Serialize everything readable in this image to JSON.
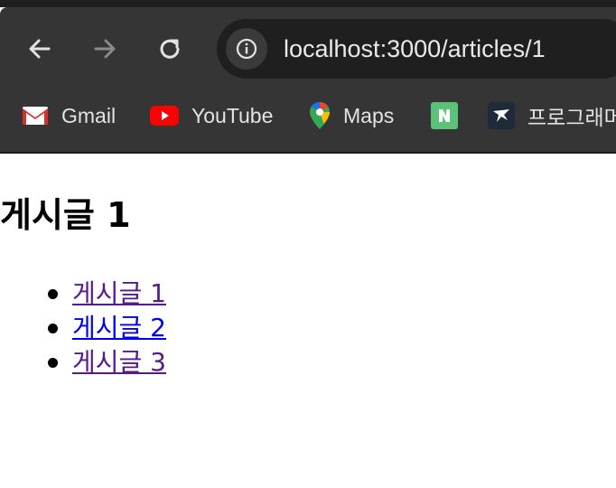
{
  "browser": {
    "url": "localhost:3000/articles/1",
    "bookmarks": [
      {
        "label": "Gmail",
        "icon": "gmail-icon"
      },
      {
        "label": "YouTube",
        "icon": "youtube-icon"
      },
      {
        "label": "Maps",
        "icon": "maps-icon"
      },
      {
        "label": "",
        "icon": "naver-icon"
      },
      {
        "label": "프로그래머",
        "icon": "programmers-icon"
      }
    ]
  },
  "page": {
    "title": "게시글 1",
    "articles": [
      {
        "label": "게시글 1",
        "visited": true
      },
      {
        "label": "게시글 2",
        "visited": false
      },
      {
        "label": "게시글 3",
        "visited": true
      }
    ]
  },
  "colors": {
    "toolbar": "#353535",
    "link_visited": "#551a8b",
    "link_unvisited": "#0000ee"
  }
}
